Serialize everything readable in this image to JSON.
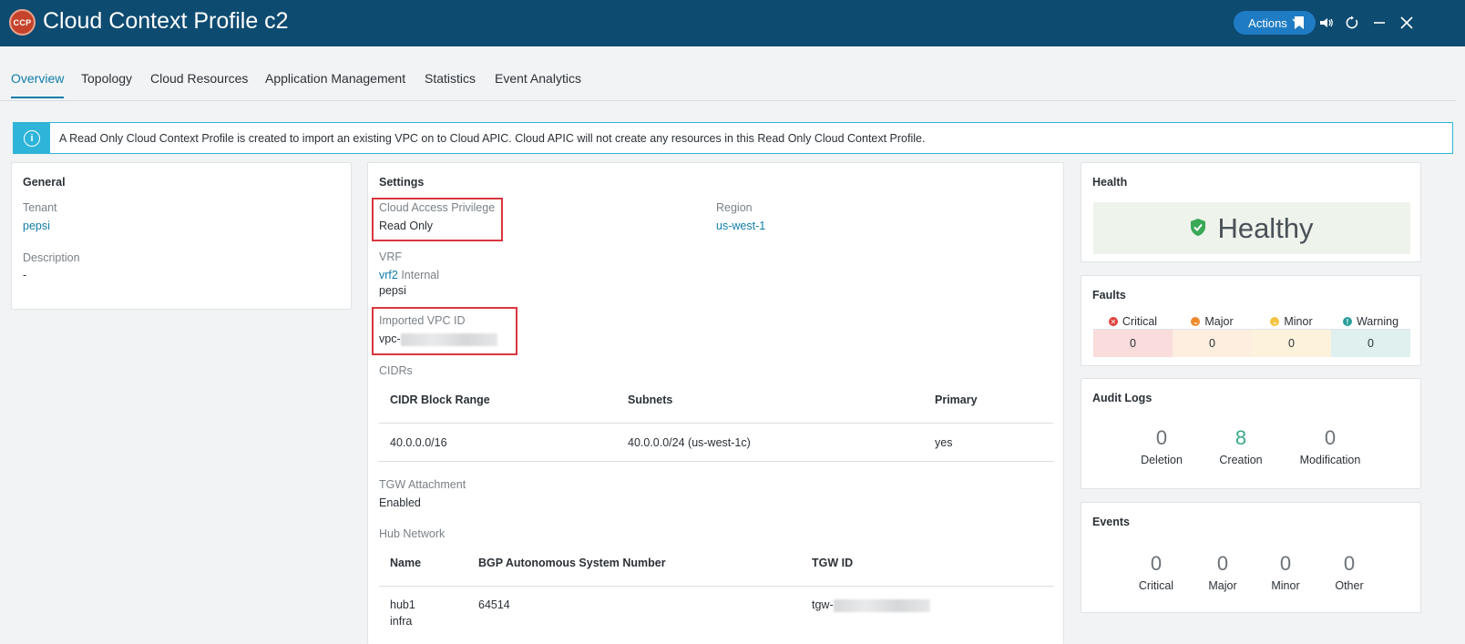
{
  "header": {
    "badge": "CCP",
    "title": "Cloud Context Profile c2",
    "actions_label": "Actions",
    "icons": [
      "bookmark-icon",
      "feedback-icon",
      "refresh-icon",
      "minimize-icon",
      "close-icon"
    ]
  },
  "tabs": [
    {
      "label": "Overview",
      "active": true
    },
    {
      "label": "Topology"
    },
    {
      "label": "Cloud Resources"
    },
    {
      "label": "Application Management"
    },
    {
      "label": "Statistics"
    },
    {
      "label": "Event Analytics"
    }
  ],
  "banner": {
    "text": "A Read Only Cloud Context Profile is created to import an existing VPC on to Cloud APIC. Cloud APIC will not create any resources in this Read Only Cloud Context Profile."
  },
  "general": {
    "title": "General",
    "tenant_label": "Tenant",
    "tenant_value": "pepsi",
    "description_label": "Description",
    "description_value": "-"
  },
  "settings": {
    "title": "Settings",
    "access_label": "Cloud Access Privilege",
    "access_value": "Read Only",
    "region_label": "Region",
    "region_value": "us-west-1",
    "vrf_label": "VRF",
    "vrf_name": "vrf2",
    "vrf_type": "Internal",
    "vrf_tenant": "pepsi",
    "vpc_label": "Imported VPC ID",
    "vpc_prefix": "vpc-",
    "cidrs_label": "CIDRs",
    "cidr_table": {
      "headers": [
        "CIDR Block Range",
        "Subnets",
        "Primary"
      ],
      "rows": [
        [
          "40.0.0.0/16",
          "40.0.0.0/24 (us-west-1c)",
          "yes"
        ]
      ]
    },
    "tgw_label": "TGW Attachment",
    "tgw_value": "Enabled",
    "hub_label": "Hub Network",
    "hub_table": {
      "headers": [
        "Name",
        "BGP Autonomous System Number",
        "TGW ID"
      ],
      "rows": [
        {
          "name": "hub1",
          "sub": "infra",
          "asn": "64514",
          "tgw_prefix": "tgw-"
        }
      ]
    }
  },
  "health": {
    "title": "Health",
    "status": "Healthy",
    "color": "#3aa857"
  },
  "faults": {
    "title": "Faults",
    "items": [
      {
        "label": "Critical",
        "value": "0",
        "color": "#e2403b",
        "bg": "#f9dcdb"
      },
      {
        "label": "Major",
        "value": "0",
        "color": "#ef8a2c",
        "bg": "#fdeedf"
      },
      {
        "label": "Minor",
        "value": "0",
        "color": "#f5c342",
        "bg": "#fdf3dc"
      },
      {
        "label": "Warning",
        "value": "0",
        "color": "#2b9e9a",
        "bg": "#dff0ee"
      }
    ]
  },
  "audit": {
    "title": "Audit Logs",
    "items": [
      {
        "value": "0",
        "label": "Deletion"
      },
      {
        "value": "8",
        "label": "Creation"
      },
      {
        "value": "0",
        "label": "Modification"
      }
    ]
  },
  "events": {
    "title": "Events",
    "items": [
      {
        "value": "0",
        "label": "Critical"
      },
      {
        "value": "0",
        "label": "Major"
      },
      {
        "value": "0",
        "label": "Minor"
      },
      {
        "value": "0",
        "label": "Other"
      }
    ]
  }
}
